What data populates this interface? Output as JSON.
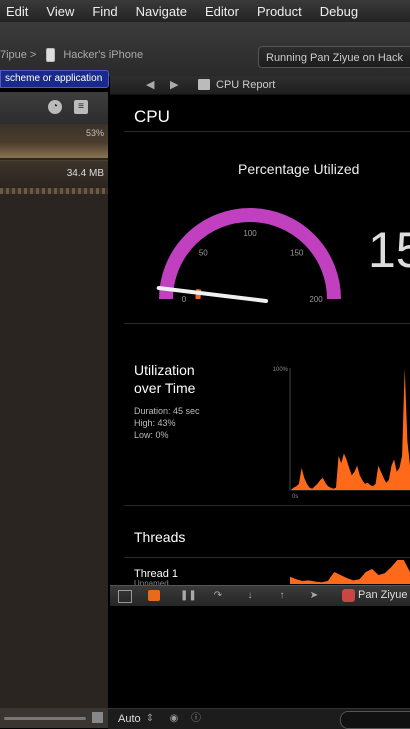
{
  "menubar": {
    "items": [
      "Edit",
      "View",
      "Find",
      "Navigate",
      "Editor",
      "Product",
      "Debug"
    ]
  },
  "toolbar": {
    "scheme_prefix": "7ipue",
    "scheme_sep": ">",
    "device": "Hacker's iPhone",
    "status": "Running Pan Ziyue on Hack"
  },
  "tooltip": {
    "text": "scheme or application"
  },
  "sidebar": {
    "cpu_value": "53%",
    "memory_value": "34.4 MB"
  },
  "jumpbar": {
    "back": "◀",
    "forward": "▶",
    "title": "CPU Report"
  },
  "report": {
    "title": "CPU",
    "gauge": {
      "title": "Percentage Utilized",
      "ticks": [
        "0",
        "50",
        "100",
        "150",
        "200"
      ],
      "needle_value": 12,
      "max": 200,
      "big_value": "15"
    },
    "utilization": {
      "title_line1": "Utilization",
      "title_line2": "over Time",
      "duration": "Duration: 45 sec",
      "high": "High: 43%",
      "low": "Low: 0%",
      "y_top_label": "100%",
      "y_bottom_label": "0s"
    },
    "threads": {
      "title": "Threads",
      "thread1": "Thread 1",
      "thread1_sub": "Unnamed"
    }
  },
  "chart_data": {
    "type": "area",
    "x": [
      0,
      1,
      2,
      3,
      4,
      5,
      6,
      7,
      8,
      9,
      10,
      11,
      12,
      13,
      14,
      15,
      16,
      17,
      18,
      19,
      20,
      21,
      22,
      23,
      24,
      25,
      26,
      27,
      28,
      29,
      30,
      31,
      32,
      33,
      34,
      35,
      36,
      37,
      38,
      39,
      40,
      41,
      42,
      43,
      44,
      45
    ],
    "values": [
      0,
      2,
      3,
      5,
      18,
      10,
      5,
      2,
      1,
      3,
      5,
      8,
      10,
      6,
      3,
      2,
      1,
      2,
      28,
      22,
      30,
      25,
      18,
      12,
      15,
      20,
      12,
      8,
      5,
      6,
      4,
      3,
      5,
      20,
      15,
      10,
      6,
      8,
      20,
      25,
      15,
      18,
      28,
      100,
      40,
      20
    ],
    "ylim": [
      0,
      100
    ],
    "color": "#ff6a1a"
  },
  "bottombar": {
    "process": "Pan Ziyue"
  },
  "console": {
    "auto_label": "Auto"
  }
}
